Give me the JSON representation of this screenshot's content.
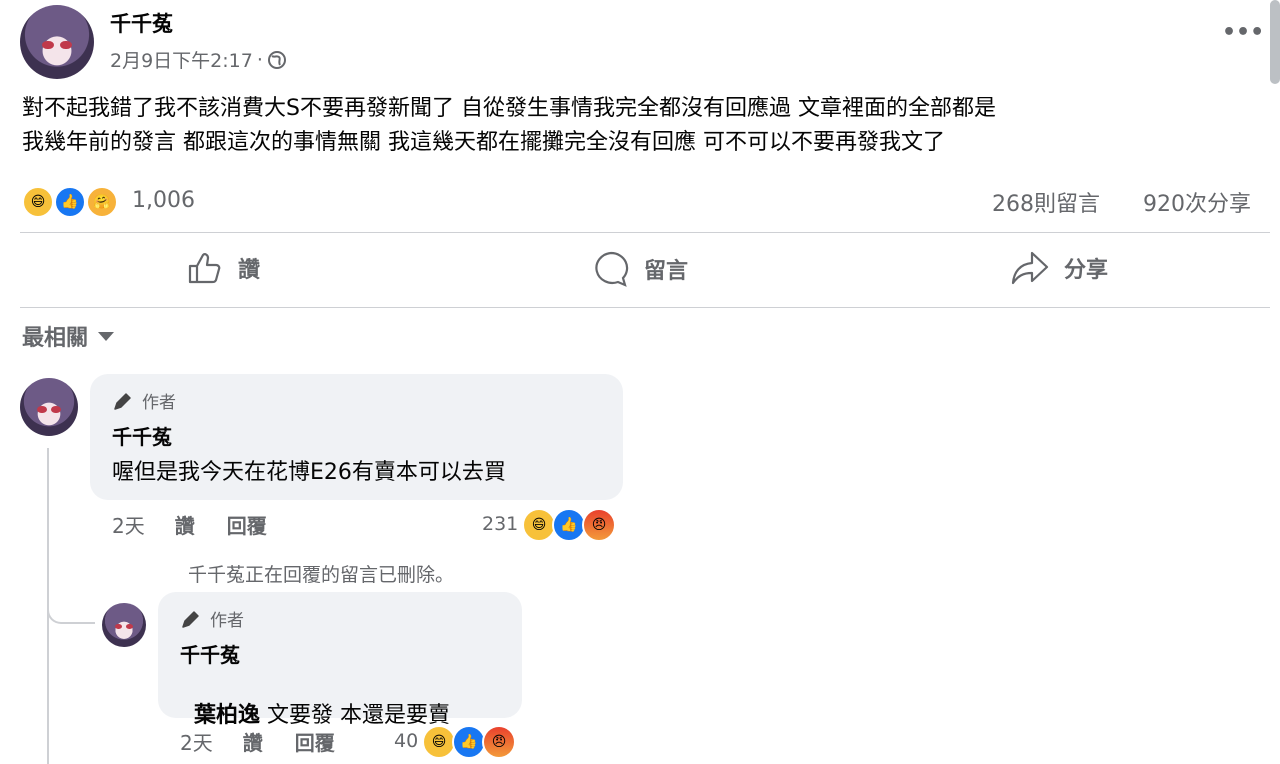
{
  "post": {
    "author": "千千菟",
    "timestamp": "2月9日下午2:17",
    "separator": "·",
    "privacy_icon": "globe-icon",
    "more_icon": "more-options-icon",
    "text_line1": "對不起我錯了我不該消費大S不要再發新聞了 自從發生事情我完全都沒有回應過 文章裡面的全部都是",
    "text_line2": "我幾年前的發言 都跟這次的事情無關 我這幾天都在擺攤完全沒有回應 可不可以不要再發我文了",
    "reaction_count": "1,006",
    "comments_count": "268則留言",
    "shares_count": "920次分享",
    "reaction_icons": [
      "haha-reaction-icon",
      "like-reaction-icon",
      "care-reaction-icon"
    ]
  },
  "actions": {
    "like_label": "讚",
    "comment_label": "留言",
    "share_label": "分享"
  },
  "sort": {
    "label": "最相關"
  },
  "comments": [
    {
      "badge": "作者",
      "author": "千千菟",
      "text": "喔但是我今天在花博E26有賣本可以去買",
      "time": "2天",
      "like": "讚",
      "reply": "回覆",
      "reaction_count": "231",
      "reaction_icons": [
        "haha-reaction-icon",
        "like-reaction-icon",
        "angry-reaction-icon"
      ]
    }
  ],
  "deleted_notice": "千千菟正在回覆的留言已刪除。",
  "reply": {
    "badge": "作者",
    "author": "千千菟",
    "mention": "葉柏逸",
    "text": " 文要發 本還是要賣",
    "time": "2天",
    "like": "讚",
    "reply": "回覆",
    "reaction_count": "40",
    "reaction_icons": [
      "haha-reaction-icon",
      "like-reaction-icon",
      "angry-reaction-icon"
    ]
  },
  "colors": {
    "like_blue": "#1877f2",
    "muted": "#65676b",
    "bubble": "#f0f2f5"
  }
}
